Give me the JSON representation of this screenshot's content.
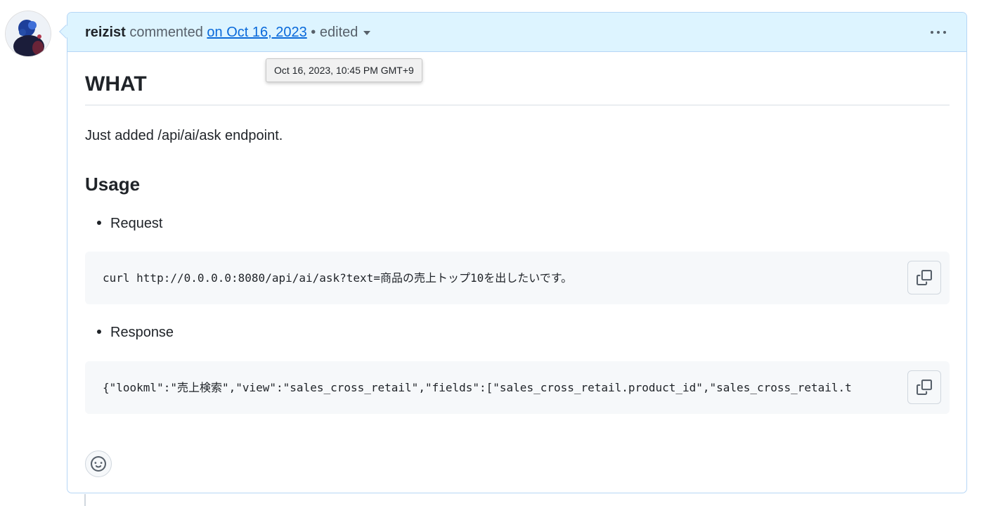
{
  "comment": {
    "author": "reizist",
    "action_text": " commented ",
    "date_link": "on Oct 16, 2023",
    "separator": " • ",
    "edited_label": "edited",
    "tooltip": "Oct 16, 2023, 10:45 PM GMT+9"
  },
  "body": {
    "heading_what": "WHAT",
    "paragraph": "Just added /api/ai/ask endpoint.",
    "heading_usage": "Usage",
    "request_label": "Request",
    "request_code": "curl http://0.0.0.0:8080/api/ai/ask?text=商品の売上トップ10を出したいです。",
    "response_label": "Response",
    "response_code": "{\"lookml\":\"売上検索\",\"view\":\"sales_cross_retail\",\"fields\":[\"sales_cross_retail.product_id\",\"sales_cross_retail.t"
  },
  "icons": {
    "avatar": "avatar-image",
    "header_menu": "kebab-horizontal-icon",
    "edited_dropdown": "triangle-down-icon",
    "copy": "copy-icon",
    "reaction": "smiley-icon"
  },
  "colors": {
    "header_bg": "#ddf4ff",
    "header_border": "#b6d6f6",
    "link": "#0969da",
    "code_bg": "#f6f8fa"
  }
}
